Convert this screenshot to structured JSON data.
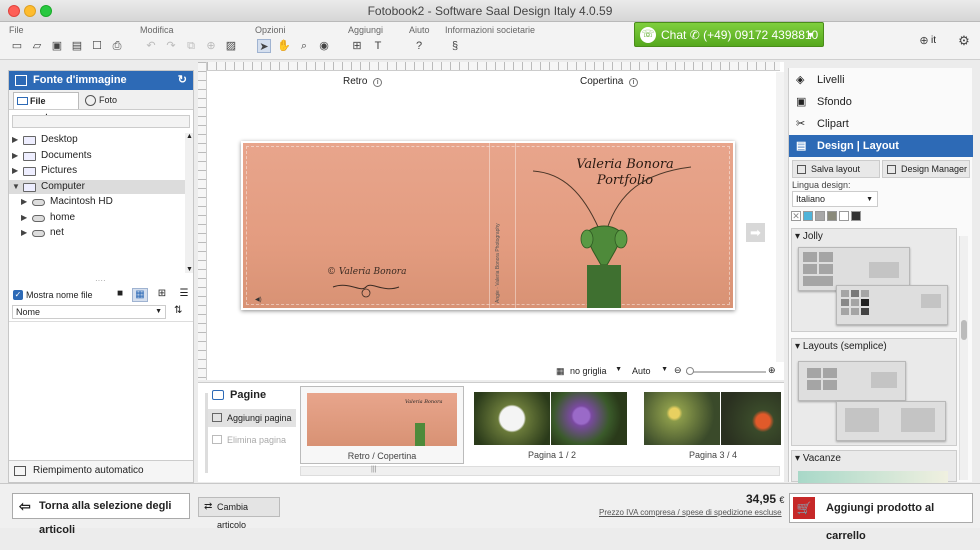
{
  "window": {
    "title": "Fotobook2 - Software Saal Design Italy 4.0.59"
  },
  "menu_groups": [
    "File",
    "Modifica",
    "Opzioni",
    "Aggiungi",
    "Aiuto",
    "Informazioni societarie"
  ],
  "chat": {
    "label": "Chat",
    "phone": "(+49) 09172 4398810"
  },
  "language": "it",
  "left_panel": {
    "title": "Fonte d'immagine",
    "tabs": [
      "File system",
      "Foto"
    ],
    "tree": [
      {
        "label": "Desktop",
        "level": 1,
        "expanded": false
      },
      {
        "label": "Documents",
        "level": 1,
        "expanded": false
      },
      {
        "label": "Pictures",
        "level": 1,
        "expanded": false
      },
      {
        "label": "Computer",
        "level": 1,
        "expanded": true,
        "selected": true
      },
      {
        "label": "Macintosh HD",
        "level": 2,
        "expanded": false
      },
      {
        "label": "home",
        "level": 2,
        "expanded": false
      },
      {
        "label": "net",
        "level": 2,
        "expanded": false
      }
    ],
    "show_filename_label": "Mostra nome file",
    "show_filename_checked": true,
    "sort_value": "Nome",
    "auto_fill": "Riempimento automatico"
  },
  "canvas": {
    "labels": {
      "back": "Retro",
      "cover": "Copertina"
    },
    "cover_title_line1": "Valeria Bonora",
    "cover_title_line2": "Portfolio",
    "back_signature": "Valeria Bonora",
    "spine_text": "Angie · Valeria Bonora Photography",
    "grid_value": "no griglia",
    "zoom_value": "Auto"
  },
  "pages_panel": {
    "title": "Pagine",
    "add_page": "Aggiungi pagina",
    "delete_page": "Elimina pagina",
    "thumbnails": [
      "Retro / Copertina",
      "Pagina 1 / 2",
      "Pagina 3 / 4"
    ]
  },
  "right_panel": {
    "menu": [
      "Livelli",
      "Sfondo",
      "Clipart",
      "Design | Layout"
    ],
    "active_menu": "Design | Layout",
    "save_layout": "Salva layout",
    "design_manager": "Design Manager",
    "design_language_label": "Lingua design:",
    "design_language_value": "Italiano",
    "swatch_colors": [
      "#ffffff",
      "#4fb3d9",
      "#a8a8a8",
      "#8a8a7a",
      "#ffffff",
      "#333333"
    ],
    "sections": [
      "Jolly",
      "Layouts (semplice)",
      "Vacanze"
    ]
  },
  "footer": {
    "back_button": "Torna alla selezione degli articoli",
    "change_item": "Cambia articolo",
    "price": "34,95",
    "currency": "€",
    "price_note": "Prezzo IVA compresa / spese di spedizione escluse",
    "add_to_cart": "Aggiungi prodotto al carrello"
  }
}
